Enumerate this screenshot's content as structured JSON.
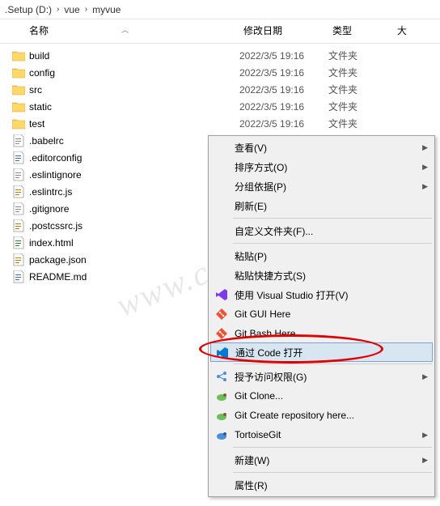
{
  "breadcrumb": {
    "a": ".Setup (D:)",
    "b": "vue",
    "c": "myvue"
  },
  "headers": {
    "name": "名称",
    "date": "修改日期",
    "type": "类型",
    "size": "大"
  },
  "folderType": "文件夹",
  "folderDate": "2022/3/5 19:16",
  "folders": [
    "build",
    "config",
    "src",
    "static",
    "test"
  ],
  "files": [
    ".babelrc",
    ".editorconfig",
    ".eslintignore",
    ".eslintrc.js",
    ".gitignore",
    ".postcssrc.js",
    "index.html",
    "package.json",
    "README.md"
  ],
  "fileIconColors": {
    ".babelrc": "#888",
    ".editorconfig": "#3b6ea5",
    ".eslintignore": "#888",
    ".eslintrc.js": "#b08000",
    ".gitignore": "#888",
    ".postcssrc.js": "#b08000",
    "index.html": "#2e7d32",
    "package.json": "#b08000",
    "README.md": "#3b6ea5"
  },
  "menu": [
    {
      "t": "查看(V)",
      "sub": true
    },
    {
      "t": "排序方式(O)",
      "sub": true
    },
    {
      "t": "分组依据(P)",
      "sub": true
    },
    {
      "t": "刷新(E)"
    },
    {
      "sep": true
    },
    {
      "t": "自定义文件夹(F)..."
    },
    {
      "sep": true
    },
    {
      "t": "粘贴(P)"
    },
    {
      "t": "粘贴快捷方式(S)"
    },
    {
      "t": "使用 Visual Studio 打开(V)",
      "ico": "vs"
    },
    {
      "t": "Git GUI Here",
      "ico": "git"
    },
    {
      "t": "Git Bash Here",
      "ico": "git"
    },
    {
      "t": "通过 Code 打开",
      "ico": "code",
      "hover": true
    },
    {
      "sep": true
    },
    {
      "t": "授予访问权限(G)",
      "ico": "share",
      "sub": true
    },
    {
      "t": "Git Clone...",
      "ico": "tort"
    },
    {
      "t": "Git Create repository here...",
      "ico": "tort"
    },
    {
      "t": "TortoiseGit",
      "ico": "tort2",
      "sub": true
    },
    {
      "sep": true
    },
    {
      "t": "新建(W)",
      "sub": true
    },
    {
      "sep": true
    },
    {
      "t": "属性(R)"
    }
  ],
  "watermark": "www.cscode开发框架"
}
